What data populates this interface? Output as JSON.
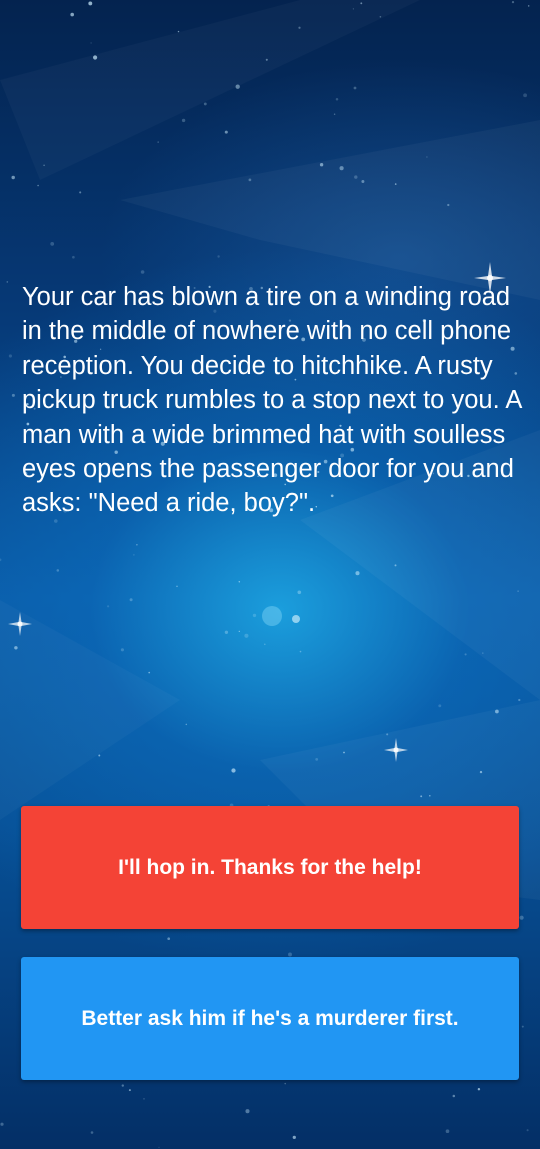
{
  "story": {
    "text": "Your car has blown a tire on a winding road in the middle of nowhere with no cell phone reception. You decide to hitchhike. A rusty pickup truck rumbles to a stop next to you. A man with a wide brimmed hat with soulless eyes opens the passenger door for you and asks: \"Need a ride, boy?\"."
  },
  "choices": [
    {
      "label": "I'll hop in. Thanks for the help!",
      "color": "#f44336"
    },
    {
      "label": "Better ask him if he's a murderer first.",
      "color": "#2196f3"
    }
  ],
  "theme": {
    "background": "starry-blue-space",
    "text_color": "#ffffff"
  }
}
